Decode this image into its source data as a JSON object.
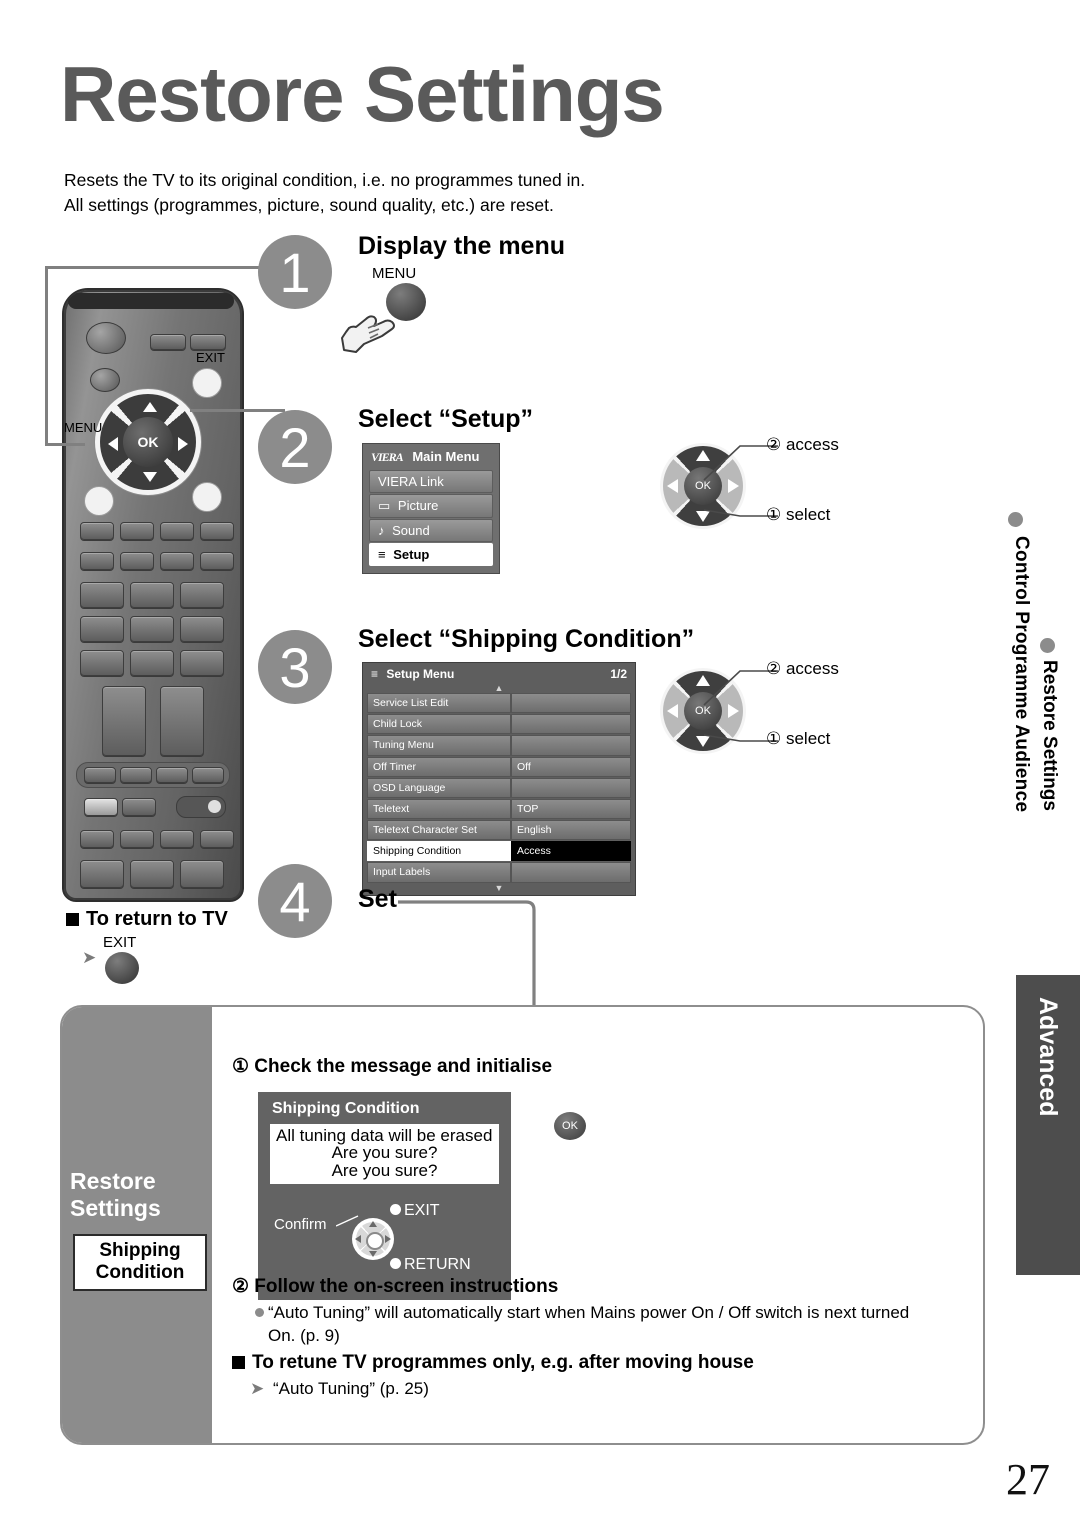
{
  "page": {
    "title": "Restore Settings",
    "number": "27",
    "intro_line1": "Resets the TV to its original condition, i.e. no programmes tuned in.",
    "intro_line2": "All settings (programmes, picture, sound quality, etc.) are reset."
  },
  "steps": [
    {
      "num": "1",
      "title": "Display the menu",
      "button_label": "MENU"
    },
    {
      "num": "2",
      "title": "Select “Setup”"
    },
    {
      "num": "3",
      "title": "Select “Shipping Condition”"
    },
    {
      "num": "4",
      "title": "Set"
    }
  ],
  "remote": {
    "menu_label": "MENU",
    "exit_label": "EXIT",
    "ok_label": "OK"
  },
  "main_menu": {
    "logo": "VIERA",
    "title": "Main Menu",
    "items": [
      {
        "label": "VIERA Link",
        "icon": "",
        "selected": false
      },
      {
        "label": "Picture",
        "icon": "▭",
        "selected": false
      },
      {
        "label": "Sound",
        "icon": "♪",
        "selected": false
      },
      {
        "label": "Setup",
        "icon": "≡",
        "selected": true
      }
    ]
  },
  "setup_menu": {
    "title": "Setup Menu",
    "icon": "list-icon",
    "page_indicator": "1/2",
    "rows": [
      {
        "name": "Service List Edit",
        "value": "",
        "selected": false
      },
      {
        "name": "Child Lock",
        "value": "",
        "selected": false
      },
      {
        "name": "Tuning Menu",
        "value": "",
        "selected": false
      },
      {
        "name": "Off Timer",
        "value": "Off",
        "selected": false
      },
      {
        "name": "OSD Language",
        "value": "",
        "selected": false
      },
      {
        "name": "Teletext",
        "value": "TOP",
        "selected": false
      },
      {
        "name": "Teletext Character Set",
        "value": "English",
        "selected": false
      },
      {
        "name": "Shipping Condition",
        "value": "Access",
        "selected": true
      },
      {
        "name": "Input Labels",
        "value": "",
        "selected": false
      }
    ]
  },
  "dpad_annotations": {
    "access": "② access",
    "select": "① select",
    "ok_label": "OK"
  },
  "return_to_tv": {
    "heading": "To return to TV",
    "button_label": "EXIT"
  },
  "bottom_panel": {
    "side_label_line1": "Restore",
    "side_label_line2": "Settings",
    "chip_line1": "Shipping",
    "chip_line2": "Condition",
    "sub1": "① Check the message and initialise",
    "sub2": "② Follow the on-screen instructions",
    "note1": "“Auto Tuning” will automatically start when Mains power On / Off switch is next turned",
    "note1b": "On. (p. 9)",
    "sub3": "To retune TV programmes only, e.g. after moving house",
    "note2": "“Auto Tuning” (p. 25)",
    "dialog": {
      "title": "Shipping Condition",
      "msg_line1": "All tuning data will be erased",
      "msg_line2": "Are you sure?",
      "msg_line3": "Are you sure?",
      "confirm_label": "Confirm",
      "exit_label": "EXIT",
      "return_label": "RETURN",
      "ok_label": "OK"
    }
  },
  "sidebar": {
    "vertical_outer": "Control Programme Audience",
    "vertical_inner": "Restore Settings",
    "tab_label": "Advanced"
  },
  "colors": {
    "title_grey": "#5a5a5a",
    "step_circle": "#8c8c8c",
    "osd_grey": "#6f6f6f",
    "tab_dark": "#4d4d4d"
  }
}
